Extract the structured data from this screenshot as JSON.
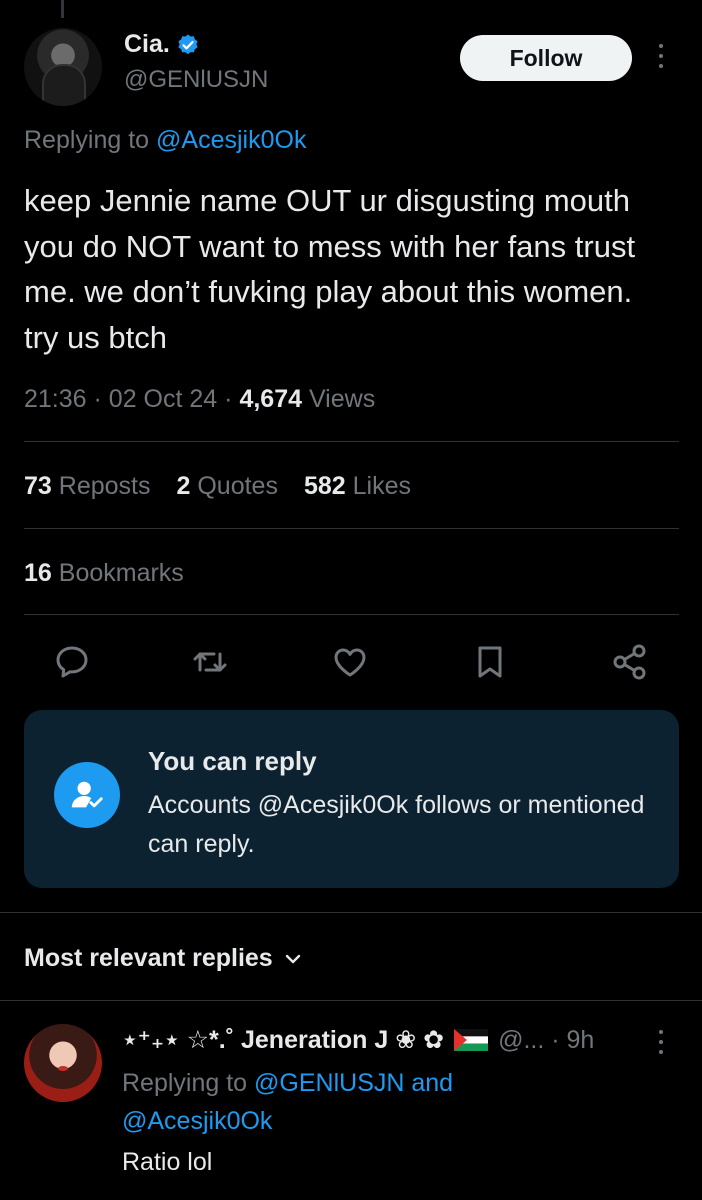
{
  "tweet": {
    "author_name": "Cia.",
    "author_handle": "@GENlUSJN",
    "follow_label": "Follow",
    "replying_prefix": "Replying to",
    "replying_mention": "@Acesjik0Ok",
    "text": "keep Jennie name OUT ur disgusting mouth you do NOT want to mess with her fans trust me. we don’t fuvking play about this women. try us btch",
    "time": "21:36",
    "date": "02 Oct 24",
    "views_count": "4,674",
    "views_label": "Views",
    "sep": "·"
  },
  "stats": {
    "reposts_count": "73",
    "reposts_label": "Reposts",
    "quotes_count": "2",
    "quotes_label": "Quotes",
    "likes_count": "582",
    "likes_label": "Likes",
    "bookmarks_count": "16",
    "bookmarks_label": "Bookmarks"
  },
  "actions": [
    "reply-icon",
    "repost-icon",
    "like-icon",
    "bookmark-icon",
    "share-icon"
  ],
  "reply_card": {
    "title": "You can reply",
    "description": "Accounts @Acesjik0Ok follows or mentioned can reply."
  },
  "replies_section": {
    "sort_label": "Most relevant replies"
  },
  "reply": {
    "name": "⋆⁺₊⋆ ☆*.˚ Jeneration J ❀ ✿",
    "handle_time": "@... · 9h",
    "replying_prefix": "Replying to",
    "mention_1": "@GENlUSJN",
    "and": "and",
    "mention_2": "@Acesjik0Ok",
    "text": "Ratio lol"
  },
  "colors": {
    "background": "#000000",
    "text": "#e7e9ea",
    "secondary": "#71767b",
    "accent": "#1d9bf0",
    "card": "#0c2231"
  }
}
